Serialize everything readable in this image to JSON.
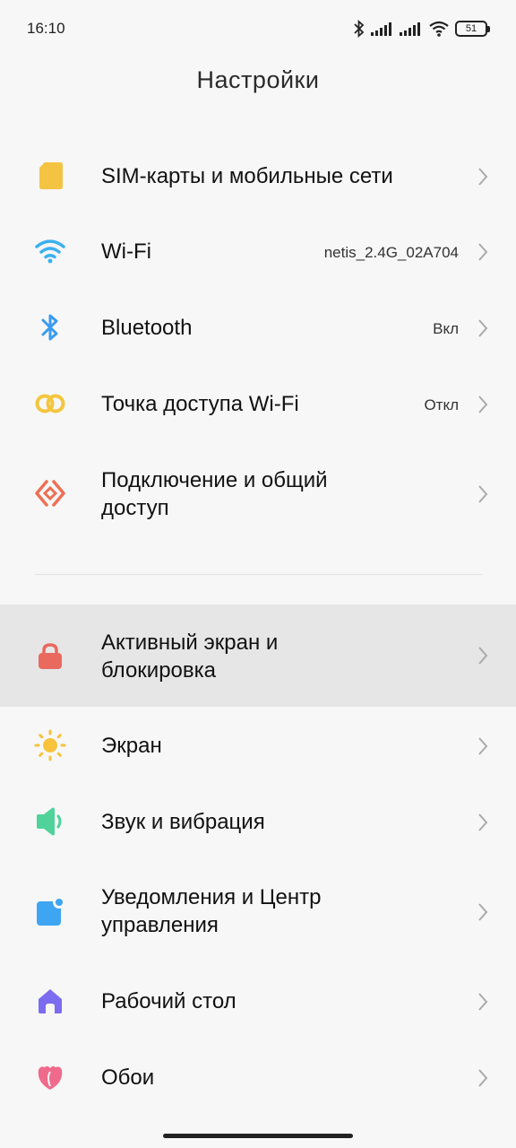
{
  "status_bar": {
    "time": "16:10",
    "battery_level": "51"
  },
  "header": {
    "title": "Настройки"
  },
  "section_connections": {
    "items": [
      {
        "label": "SIM-карты и мобильные сети",
        "value": "",
        "icon": "sim-card-icon"
      },
      {
        "label": "Wi-Fi",
        "value": "netis_2.4G_02A704",
        "icon": "wifi-icon"
      },
      {
        "label": "Bluetooth",
        "value": "Вкл",
        "icon": "bluetooth-icon"
      },
      {
        "label": "Точка доступа Wi-Fi",
        "value": "Откл",
        "icon": "hotspot-icon"
      },
      {
        "label_line1": "Подключение и общий",
        "label_line2": "доступ",
        "value": "",
        "icon": "connection-sharing-icon"
      }
    ]
  },
  "section_device": {
    "items": [
      {
        "label_line1": "Активный экран и",
        "label_line2": "блокировка",
        "icon": "lock-icon"
      },
      {
        "label": "Экран",
        "icon": "display-sun-icon"
      },
      {
        "label": "Звук и вибрация",
        "icon": "sound-icon"
      },
      {
        "label_line1": "Уведомления и Центр",
        "label_line2": "управления",
        "icon": "notifications-icon"
      },
      {
        "label": "Рабочий стол",
        "icon": "home-icon"
      },
      {
        "label": "Обои",
        "icon": "wallpaper-icon"
      }
    ]
  },
  "colors": {
    "sim": "#f5c342",
    "wifi": "#3ab0f0",
    "bluetooth": "#3a9bf0",
    "hotspot": "#f3c63f",
    "sharing": "#ee6f55",
    "lock": "#e9695e",
    "sun": "#f6c33b",
    "sound": "#4fd39a",
    "notif": "#3ea5f2",
    "home": "#7b6cf0",
    "wallpaper": "#f06a8c",
    "highlight": "#e6e6e6"
  }
}
